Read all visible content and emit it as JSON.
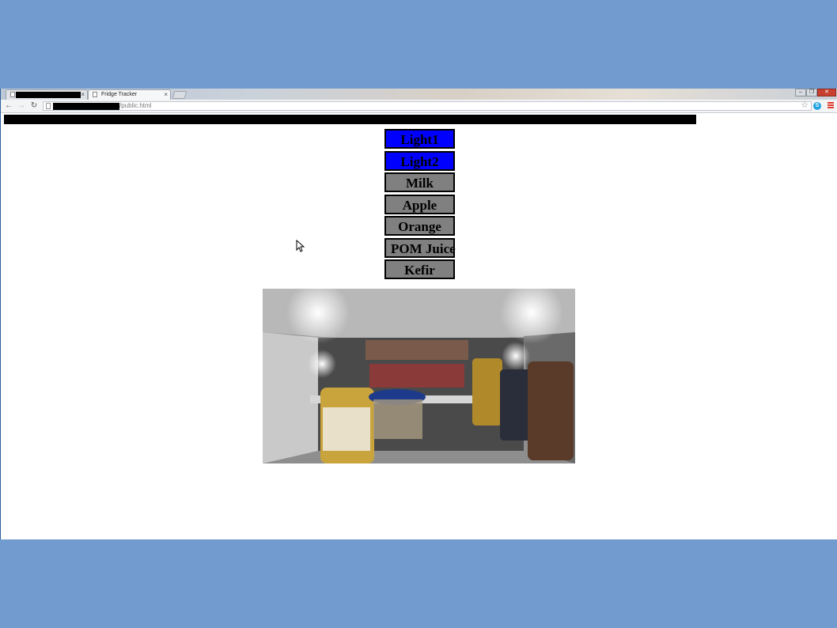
{
  "browser": {
    "tabs": [
      {
        "title": ""
      },
      {
        "title": "Fridge Tracker"
      }
    ],
    "url_suffix": "/public.html"
  },
  "controls": [
    {
      "label": "Light1",
      "state": "on",
      "color": "#0000ff"
    },
    {
      "label": "Light2",
      "state": "on",
      "color": "#0000ff"
    },
    {
      "label": "Milk",
      "state": "off",
      "color": "#808080"
    },
    {
      "label": "Apple",
      "state": "off",
      "color": "#808080"
    },
    {
      "label": "Orange",
      "state": "off",
      "color": "#808080"
    },
    {
      "label": "POM Juice",
      "state": "off",
      "color": "#808080"
    },
    {
      "label": "Kefir",
      "state": "off",
      "color": "#808080"
    }
  ],
  "camera": {
    "image": "fridge-interior-photo"
  }
}
